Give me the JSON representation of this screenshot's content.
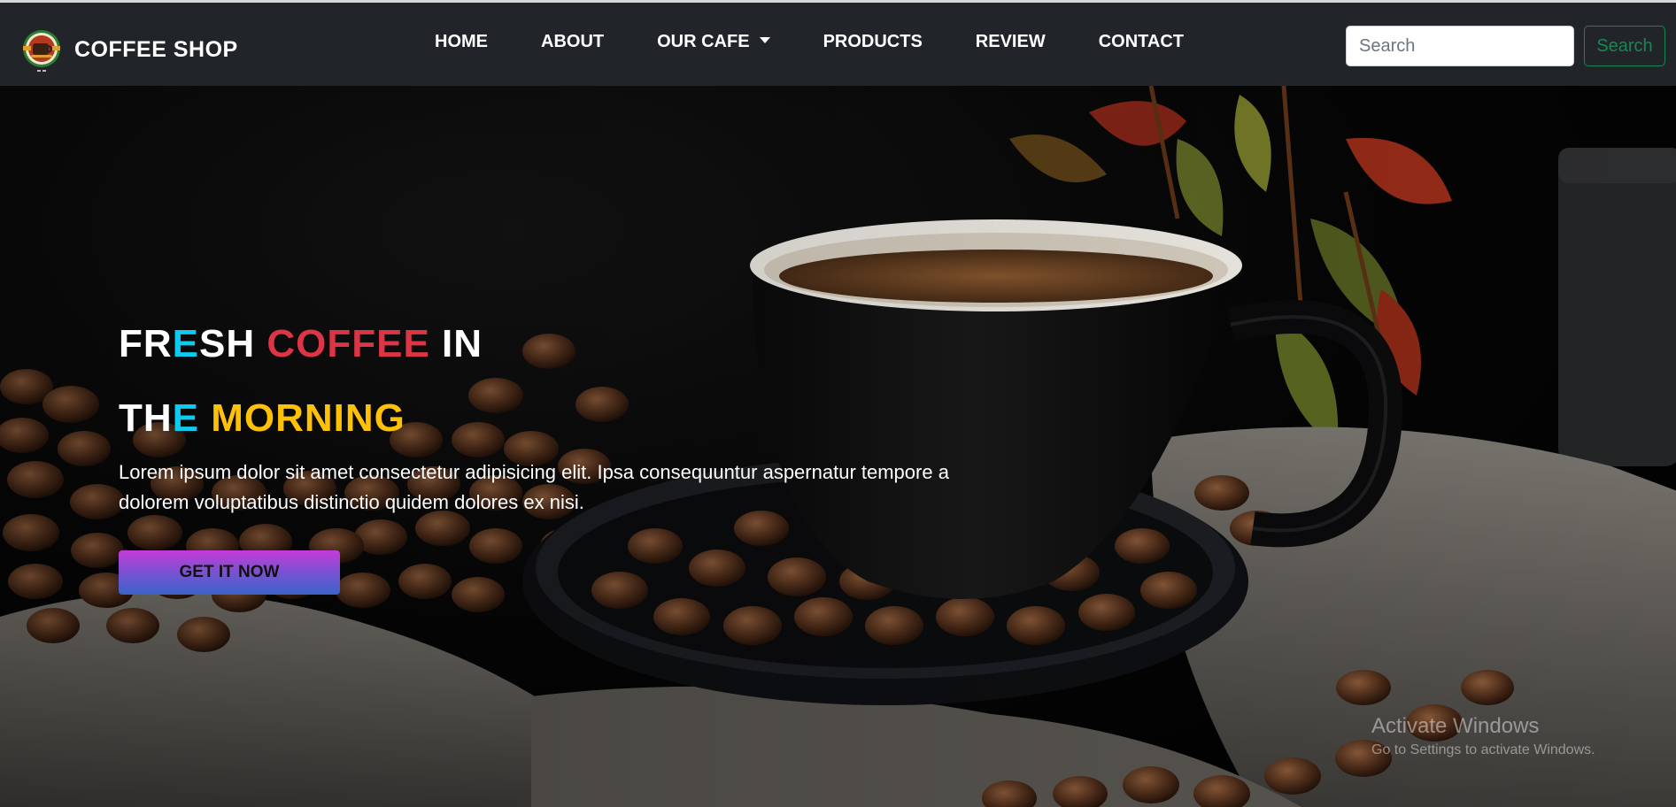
{
  "navbar": {
    "brand": "COFFEE SHOP",
    "links": [
      {
        "label": "HOME"
      },
      {
        "label": "ABOUT"
      },
      {
        "label": "OUR CAFE"
      },
      {
        "label": "PRODUCTS"
      },
      {
        "label": "REVIEW"
      },
      {
        "label": "CONTACT"
      }
    ],
    "search": {
      "placeholder": "Search",
      "value": "",
      "button_label": "Search"
    }
  },
  "hero": {
    "title_line1": {
      "a": "FR",
      "b": "E",
      "c": "SH ",
      "d": "COFFEE",
      "e": " IN"
    },
    "title_line2": {
      "a": "TH",
      "b": "E",
      "c": " MORNING"
    },
    "paragraph": "Lorem ipsum dolor sit amet consectetur adipisicing elit. Ipsa consequuntur aspernatur tempore a dolorem voluptatibus distinctio quidem dolores ex nisi.",
    "cta_label": "GET IT NOW"
  },
  "watermark": {
    "title": "Activate Windows",
    "subtitle": "Go to Settings to activate Windows."
  },
  "colors": {
    "navbar_bg": "#212529",
    "accent_blue": "#0dcaf0",
    "accent_red": "#dc3545",
    "accent_yellow": "#ffc107",
    "search_green": "#198754"
  },
  "icons": {
    "brand_logo": "coffee-cup-logo-icon",
    "dropdown": "caret-down-icon"
  }
}
